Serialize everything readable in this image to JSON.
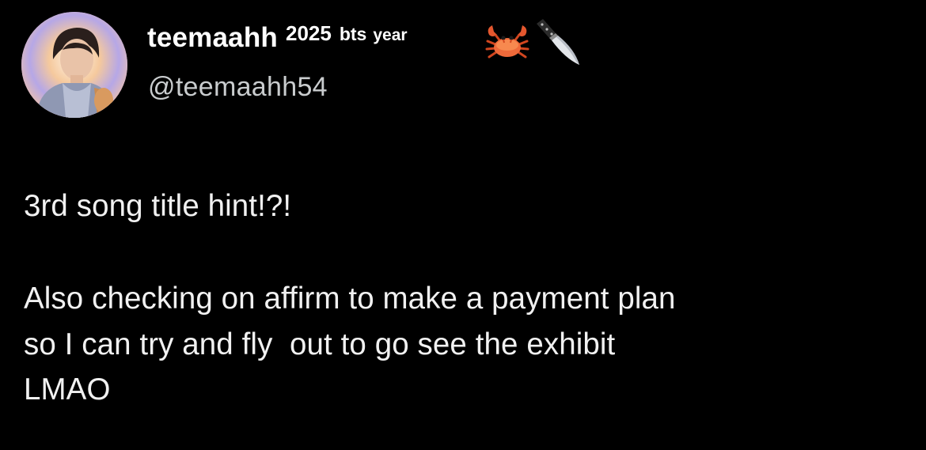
{
  "tweet": {
    "author": {
      "display_name": "teemaahh",
      "name_extras": {
        "year": "2025",
        "bts": "bts",
        "tag": "year"
      },
      "name_emojis": [
        "crab-emoji",
        "knife-emoji"
      ],
      "handle": "@teemaahh54"
    },
    "body": {
      "line1": "3rd song title hint!?!",
      "line2": "Also checking on affirm to make a payment plan",
      "line3": "so I can try and fly  out to go see the exhibit",
      "line4": "LMAO"
    }
  },
  "colors": {
    "background": "#000000",
    "text_primary": "#ffffff",
    "text_secondary": "#c9ccce"
  }
}
